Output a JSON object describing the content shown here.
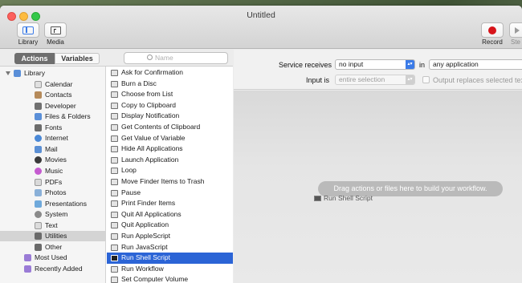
{
  "window": {
    "title": "Untitled"
  },
  "toolbar": {
    "library_label": "Library",
    "media_label": "Media",
    "record_label": "Record",
    "step_label": "Ste"
  },
  "tabs": {
    "actions": "Actions",
    "variables": "Variables",
    "search_placeholder": "Name"
  },
  "library": {
    "root": "Library",
    "items": [
      {
        "label": "Calendar",
        "icon": "calendar-icon",
        "color": "#e0e0e0"
      },
      {
        "label": "Contacts",
        "icon": "contacts-icon",
        "color": "#b58a5a"
      },
      {
        "label": "Developer",
        "icon": "developer-icon",
        "color": "#707070"
      },
      {
        "label": "Files & Folders",
        "icon": "folder-icon",
        "color": "#5a8fd8"
      },
      {
        "label": "Fonts",
        "icon": "fonts-icon",
        "color": "#6c6c6c"
      },
      {
        "label": "Internet",
        "icon": "globe-icon",
        "color": "#4a88d6"
      },
      {
        "label": "Mail",
        "icon": "mail-icon",
        "color": "#5b8fd4"
      },
      {
        "label": "Movies",
        "icon": "movies-icon",
        "color": "#3a3a3a"
      },
      {
        "label": "Music",
        "icon": "music-icon",
        "color": "#c55bd0"
      },
      {
        "label": "PDFs",
        "icon": "pdf-icon",
        "color": "#d9d9d9"
      },
      {
        "label": "Photos",
        "icon": "photos-icon",
        "color": "#8ab0d8"
      },
      {
        "label": "Presentations",
        "icon": "presentations-icon",
        "color": "#6fa9db"
      },
      {
        "label": "System",
        "icon": "system-icon",
        "color": "#8a8a8a"
      },
      {
        "label": "Text",
        "icon": "text-icon",
        "color": "#dcdcdc"
      },
      {
        "label": "Utilities",
        "icon": "utilities-icon",
        "color": "#6a6a6a"
      },
      {
        "label": "Other",
        "icon": "other-icon",
        "color": "#6a6a6a"
      }
    ],
    "most_used": "Most Used",
    "recently_added": "Recently Added"
  },
  "actions": [
    "Ask for Confirmation",
    "Burn a Disc",
    "Choose from List",
    "Copy to Clipboard",
    "Display Notification",
    "Get Contents of Clipboard",
    "Get Value of Variable",
    "Hide All Applications",
    "Launch Application",
    "Loop",
    "Move Finder Items to Trash",
    "Pause",
    "Print Finder Items",
    "Quit All Applications",
    "Quit Application",
    "Run AppleScript",
    "Run JavaScript",
    "Run Shell Script",
    "Run Workflow",
    "Set Computer Volume"
  ],
  "selected_action": "Run Shell Script",
  "service": {
    "receives_label": "Service receives",
    "receives_value": "no input",
    "in_label": "in",
    "in_value": "any application",
    "input_is_label": "Input is",
    "input_is_value": "entire selection",
    "output_label": "Output replaces selected text"
  },
  "canvas": {
    "hint": "Drag actions or files here to build your workflow.",
    "dragging": "Run Shell Script"
  },
  "colors": {
    "accent": "#2b64d6",
    "record": "#d7141a"
  }
}
